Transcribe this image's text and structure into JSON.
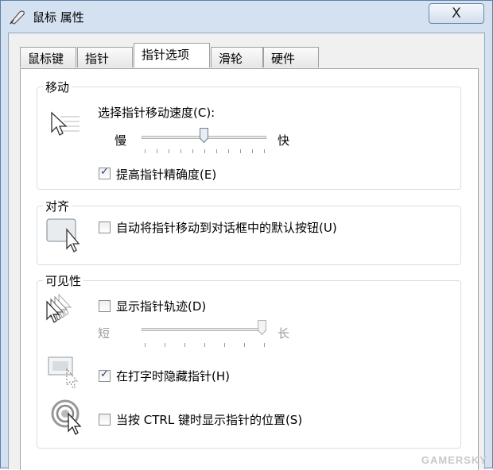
{
  "window": {
    "title": "鼠标 属性",
    "close_symbol": "X",
    "icon": "mouse-icon"
  },
  "tabs": [
    {
      "label": "鼠标键",
      "active": false
    },
    {
      "label": "指针",
      "active": false
    },
    {
      "label": "指针选项",
      "active": true
    },
    {
      "label": "滑轮",
      "active": false
    },
    {
      "label": "硬件",
      "active": false
    }
  ],
  "motion": {
    "title": "移动",
    "speed_label": "选择指针移动速度(C):",
    "slow": "慢",
    "fast": "快",
    "speed_level": 0.5,
    "precision_label": "提高指针精确度(E)",
    "precision_checked": true,
    "icon": "pointer-speed-icon"
  },
  "snap": {
    "title": "对齐",
    "label": "自动将指针移动到对话框中的默认按钮(U)",
    "checked": false,
    "icon": "snap-to-button-icon"
  },
  "visibility": {
    "title": "可见性",
    "trails_label": "显示指针轨迹(D)",
    "trails_checked": false,
    "short": "短",
    "long": "长",
    "trail_level": 1.0,
    "hide_label": "在打字时隐藏指针(H)",
    "hide_checked": true,
    "ctrl_label": "当按 CTRL 键时显示指针的位置(S)",
    "ctrl_checked": false,
    "icons": [
      "pointer-trails-icon",
      "hide-while-typing-icon",
      "ctrl-locate-icon"
    ]
  },
  "watermark": "GAMERSKY"
}
